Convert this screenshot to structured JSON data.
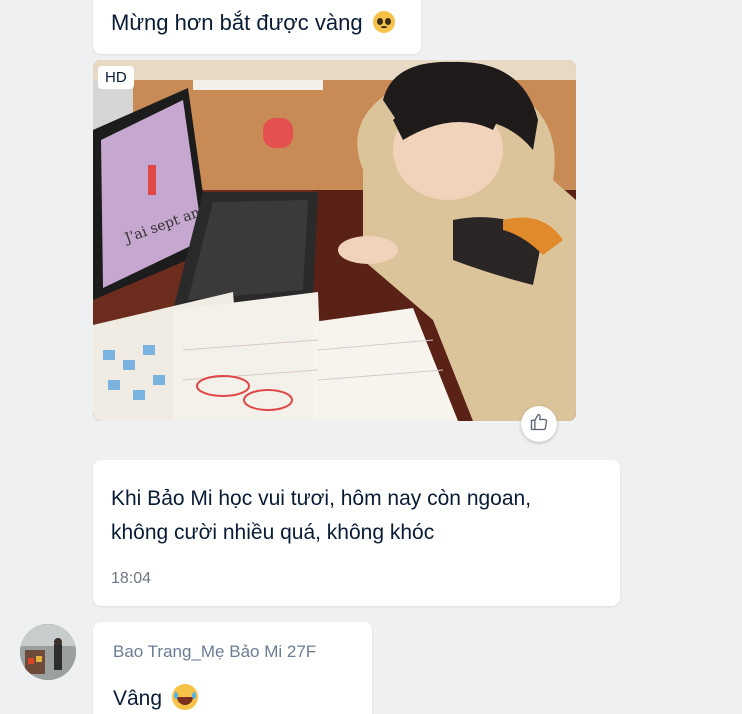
{
  "messages": [
    {
      "text": "Mừng hơn bắt được vàng",
      "emoji": "pleading-face-icon"
    },
    {
      "type": "image",
      "badge": "HD"
    },
    {
      "text_line1": "Khi Bảo Mi học vui tươi, hôm nay còn ngoan,",
      "text_line2": "không cười nhiều quá, không khóc",
      "time": "18:04"
    },
    {
      "sender": "Bao Trang_Mẹ Bảo Mi 27F",
      "text": "Vâng",
      "emoji": "laughing-tears-icon"
    }
  ],
  "colors": {
    "background": "#eef0f1",
    "bubble": "#ffffff",
    "text": "#081c36",
    "sender": "#6b7d96",
    "time": "#6c7784"
  }
}
